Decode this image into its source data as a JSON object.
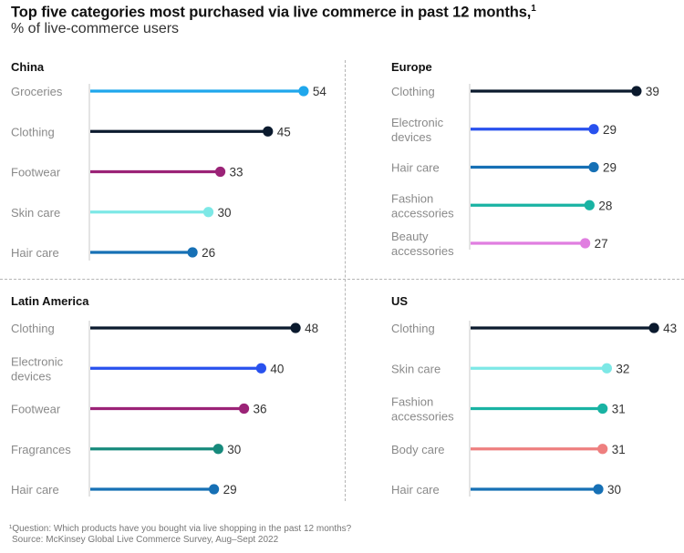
{
  "chart_data": {
    "type": "lollipop",
    "title": "Top five categories most purchased via live commerce in past 12 months,",
    "title_footnote_marker": "1",
    "subtitle": "% of live-commerce users",
    "panels": [
      {
        "name": "China",
        "categories": [
          "Groceries",
          "Clothing",
          "Footwear",
          "Skin care",
          "Hair care"
        ],
        "values": [
          54,
          45,
          33,
          30,
          26
        ],
        "colors": [
          "#1fa7ec",
          "#0b1a2e",
          "#9b2377",
          "#7de8e6",
          "#1670b5"
        ]
      },
      {
        "name": "Europe",
        "categories": [
          "Clothing",
          "Electronic devices",
          "Hair care",
          "Fashion accessories",
          "Beauty accessories"
        ],
        "values": [
          39,
          29,
          29,
          28,
          27
        ],
        "colors": [
          "#0b1a2e",
          "#2851ee",
          "#1670b5",
          "#19b3a3",
          "#e07ee0"
        ]
      },
      {
        "name": "Latin America",
        "categories": [
          "Clothing",
          "Electronic devices",
          "Footwear",
          "Fragrances",
          "Hair care"
        ],
        "values": [
          48,
          40,
          36,
          30,
          29
        ],
        "colors": [
          "#0b1a2e",
          "#2851ee",
          "#9b2377",
          "#178a7c",
          "#1670b5"
        ]
      },
      {
        "name": "US",
        "categories": [
          "Clothing",
          "Skin care",
          "Fashion accessories",
          "Body care",
          "Hair care"
        ],
        "values": [
          43,
          32,
          31,
          31,
          30
        ],
        "colors": [
          "#0b1a2e",
          "#7de8e6",
          "#19b3a3",
          "#ee7f7f",
          "#1670b5"
        ]
      }
    ],
    "xlabel": "",
    "ylabel": "",
    "grid": false,
    "legend": "none"
  },
  "footnote": {
    "question": "¹Question: Which products have you bought via live shopping in the past 12 months?",
    "source": "Source: McKinsey Global Live Commerce Survey, Aug–Sept 2022"
  }
}
